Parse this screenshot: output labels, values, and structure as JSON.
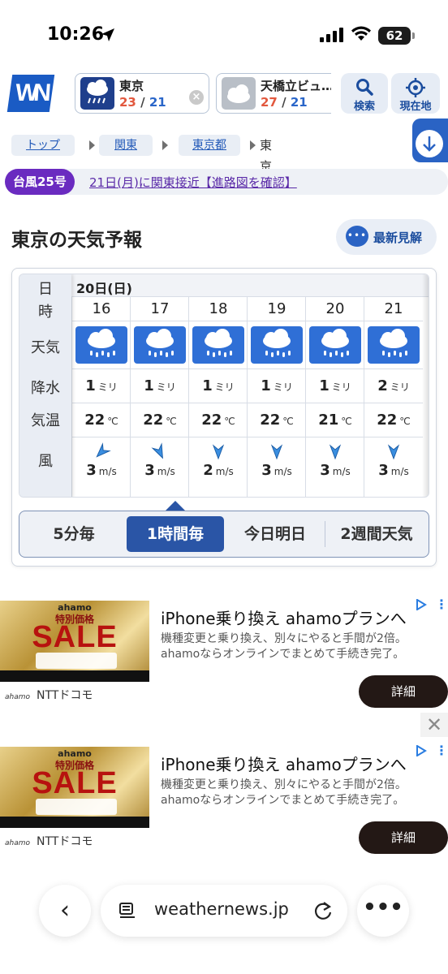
{
  "status_bar": {
    "time": "10:26",
    "battery": "62"
  },
  "header": {
    "logo": "WN",
    "locations": [
      {
        "name": "東京",
        "high": "23",
        "low": "21",
        "separator": "/",
        "icon": "heavy-rain-icon"
      },
      {
        "name": "天橋立ビュ…",
        "high": "27",
        "low": "21",
        "separator": "/",
        "icon": "cloudy-icon"
      }
    ],
    "search_label": "検索",
    "location_label": "現在地"
  },
  "breadcrumb": {
    "items": [
      "トップ",
      "関東",
      "東京都"
    ],
    "current": "東京"
  },
  "typhoon": {
    "badge": "台風25号",
    "link": "21日(月)に関東接近【進路図を確認】"
  },
  "page": {
    "title": "東京の天気予報",
    "latest_label": "最新見解"
  },
  "forecast": {
    "row_labels": [
      "日",
      "時",
      "天気",
      "降水",
      "気温",
      "風"
    ],
    "day": "20日(日)",
    "precip_unit": "ミリ",
    "temp_unit": "℃",
    "wind_unit": "m/s",
    "hours": [
      {
        "hour": "16",
        "weather": "rain",
        "precip": "1",
        "temp": "22",
        "wind": "3",
        "wind_dir": "NE"
      },
      {
        "hour": "17",
        "weather": "rain",
        "precip": "1",
        "temp": "22",
        "wind": "3",
        "wind_dir": "NNW"
      },
      {
        "hour": "18",
        "weather": "rain",
        "precip": "1",
        "temp": "22",
        "wind": "2",
        "wind_dir": "N"
      },
      {
        "hour": "19",
        "weather": "rain",
        "precip": "1",
        "temp": "22",
        "wind": "3",
        "wind_dir": "N"
      },
      {
        "hour": "20",
        "weather": "rain",
        "precip": "1",
        "temp": "21",
        "wind": "3",
        "wind_dir": "N"
      },
      {
        "hour": "21",
        "weather": "rain",
        "precip": "2",
        "temp": "22",
        "wind": "3",
        "wind_dir": "N"
      }
    ],
    "tabs": [
      "5分毎",
      "1時間毎",
      "今日明日",
      "2週間天気"
    ],
    "active_tab": "1時間毎"
  },
  "ads": [
    {
      "image_brand": "ahamo",
      "image_price": "特別価格",
      "image_sale": "SALE",
      "headline": "iPhone乗り換え ahamoプランへ",
      "description": "機種変更と乗り換え、別々にやると手間が2倍。ahamoならオンラインでまとめて手続き完了。",
      "advertiser_small": "ahamo",
      "advertiser": "NTTドコモ",
      "cta": "詳細"
    },
    {
      "image_brand": "ahamo",
      "image_price": "特別価格",
      "image_sale": "SALE",
      "headline": "iPhone乗り換え ahamoプランへ",
      "description": "機種変更と乗り換え、別々にやると手間が2倍。ahamoならオンラインでまとめて手続き完了。",
      "advertiser_small": "ahamo",
      "advertiser": "NTTドコモ",
      "cta": "詳細"
    }
  ],
  "browser": {
    "url": "weathernews.jp"
  },
  "colors": {
    "brand_blue": "#2a55a6",
    "high_temp": "#e2583e",
    "low_temp": "#2a66c9",
    "typhoon_purple": "#6a2bc0"
  }
}
